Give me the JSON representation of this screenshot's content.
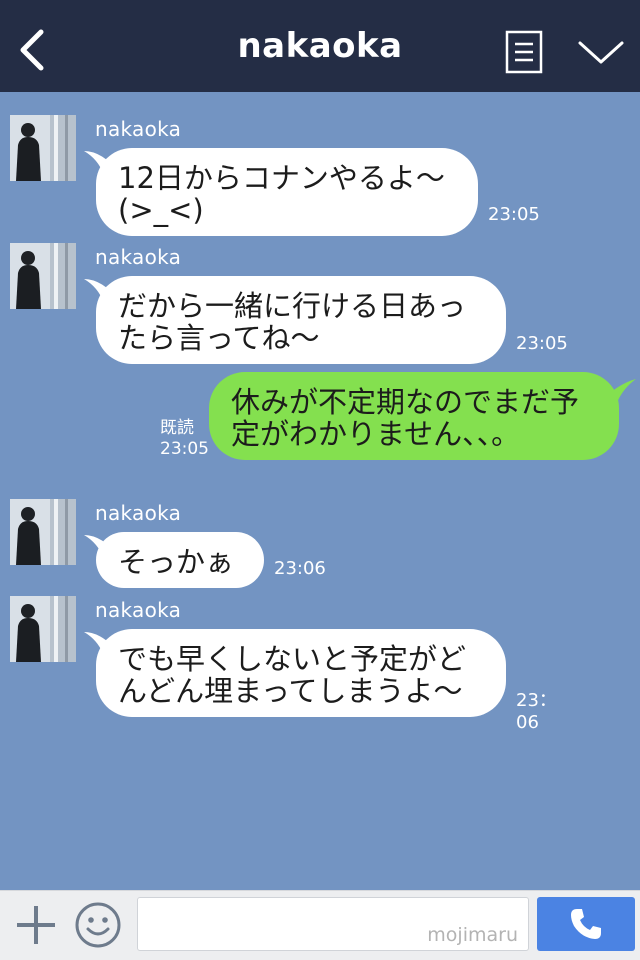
{
  "header": {
    "title": "nakaoka",
    "back_icon": "chevron-left-icon",
    "menu_icon": "document-menu-icon",
    "collapse_icon": "chevron-down-icon",
    "background": "#242d45"
  },
  "chat": {
    "background": "#7394c2",
    "messages": [
      {
        "direction": "incoming",
        "sender": "nakaoka",
        "text": "12日からコナンやるよ〜\n(>_<)",
        "time": "23:05"
      },
      {
        "direction": "incoming",
        "sender": "nakaoka",
        "text": "だから一緒に行ける日あっ\nたら言ってね〜",
        "time": "23:05"
      },
      {
        "direction": "outgoing",
        "text": "休みが不定期なのでまだ予\n定がわかりません、、。",
        "read_label": "既読",
        "time": "23:05"
      },
      {
        "direction": "incoming",
        "sender": "nakaoka",
        "text": "そっかぁ",
        "time": "23:06"
      },
      {
        "direction": "incoming",
        "sender": "nakaoka",
        "text": "でも早くしないと予定がど\nんどん埋まってしまうよ〜",
        "time": "23：06"
      }
    ]
  },
  "footer": {
    "plus_icon": "plus-icon",
    "emoji_icon": "smiley-icon",
    "input_value": "",
    "watermark": "mojimaru",
    "send_icon": "phone-icon",
    "send_color": "#4b83e3"
  },
  "colors": {
    "incoming_bubble": "#ffffff",
    "outgoing_bubble": "#84e04f"
  }
}
